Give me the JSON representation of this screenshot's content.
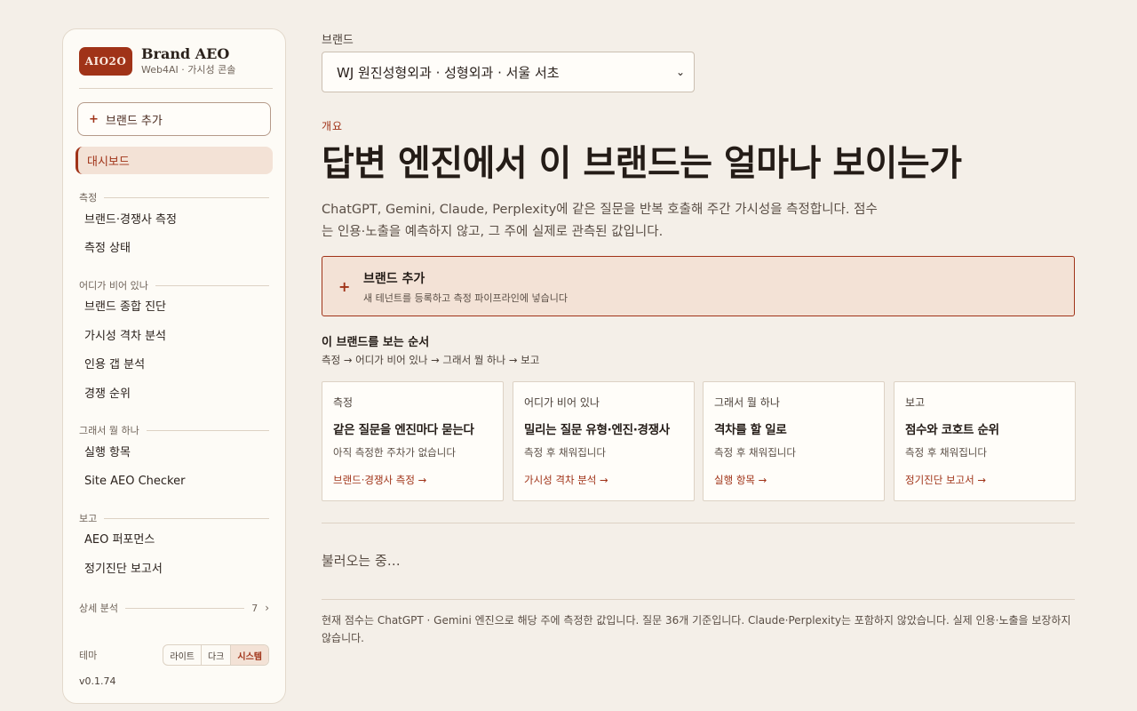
{
  "sidebar": {
    "logo_badge": "AIO2O",
    "logo_title": "Brand AEO",
    "logo_sub": "Web4AI · 가시성 콘솔",
    "add_brand": "브랜드 추가",
    "active_item": "대시보드",
    "sections": {
      "measure": {
        "label": "측정",
        "items": [
          "브랜드·경쟁사 측정",
          "측정 상태"
        ]
      },
      "where": {
        "label": "어디가 비어 있나",
        "items": [
          "브랜드 종합 진단",
          "가시성 격차 분석",
          "인용 갭 분석",
          "경쟁 순위"
        ]
      },
      "todo": {
        "label": "그래서 뭘 하나",
        "items": [
          "실행 항목",
          "Site AEO Checker"
        ]
      },
      "report": {
        "label": "보고",
        "items": [
          "AEO 퍼포먼스",
          "정기진단 보고서"
        ]
      }
    },
    "detail": {
      "label": "상세 분석",
      "count": "7"
    },
    "theme": {
      "label": "테마",
      "options": [
        "라이트",
        "다크",
        "시스템"
      ],
      "selected": "시스템"
    },
    "version": "v0.1.74"
  },
  "main": {
    "brand_label": "브랜드",
    "brand_select_value": "WJ 원진성형외과 · 성형외과 · 서울 서초",
    "eyebrow": "개요",
    "headline": "답변 엔진에서 이 브랜드는 얼마나 보이는가",
    "lede": "ChatGPT, Gemini, Claude, Perplexity에 같은 질문을 반복 호출해 주간 가시성을 측정합니다. 점수는 인용·노출을 예측하지 않고, 그 주에 실제로 관측된 값입니다.",
    "add_card": {
      "title": "브랜드 추가",
      "sub": "새 테넌트를 등록하고 측정 파이프라인에 넣습니다"
    },
    "order_title": "이 브랜드를 보는 순서",
    "order_path": "측정 → 어디가 비어 있나 → 그래서 뭘 하나 → 보고",
    "cards": [
      {
        "eyebrow": "측정",
        "title": "같은 질문을 엔진마다 묻는다",
        "sub": "아직 측정한 주차가 없습니다",
        "link": "브랜드·경쟁사 측정 →"
      },
      {
        "eyebrow": "어디가 비어 있나",
        "title": "밀리는 질문 유형·엔진·경쟁사",
        "sub": "측정 후 채워집니다",
        "link": "가시성 격차 분석 →"
      },
      {
        "eyebrow": "그래서 뭘 하나",
        "title": "격차를 할 일로",
        "sub": "측정 후 채워집니다",
        "link": "실행 항목 →"
      },
      {
        "eyebrow": "보고",
        "title": "점수와 코호트 순위",
        "sub": "측정 후 채워집니다",
        "link": "정기진단 보고서 →"
      }
    ],
    "loading": "불러오는 중…",
    "footnote": "현재 점수는 ChatGPT · Gemini 엔진으로 해당 주에 측정한 값입니다. 질문 36개 기준입니다. Claude·Perplexity는 포함하지 않았습니다. 실제 인용·노출을 보장하지 않습니다."
  },
  "colors": {
    "accent": "#a03318",
    "background": "#f4efe8",
    "panel": "#fdfbf6",
    "highlight": "#f3e2d6"
  },
  "icons": {
    "plus": "plus-icon",
    "chevron": "chevron-right-icon",
    "select": "chevron-down-icon"
  }
}
